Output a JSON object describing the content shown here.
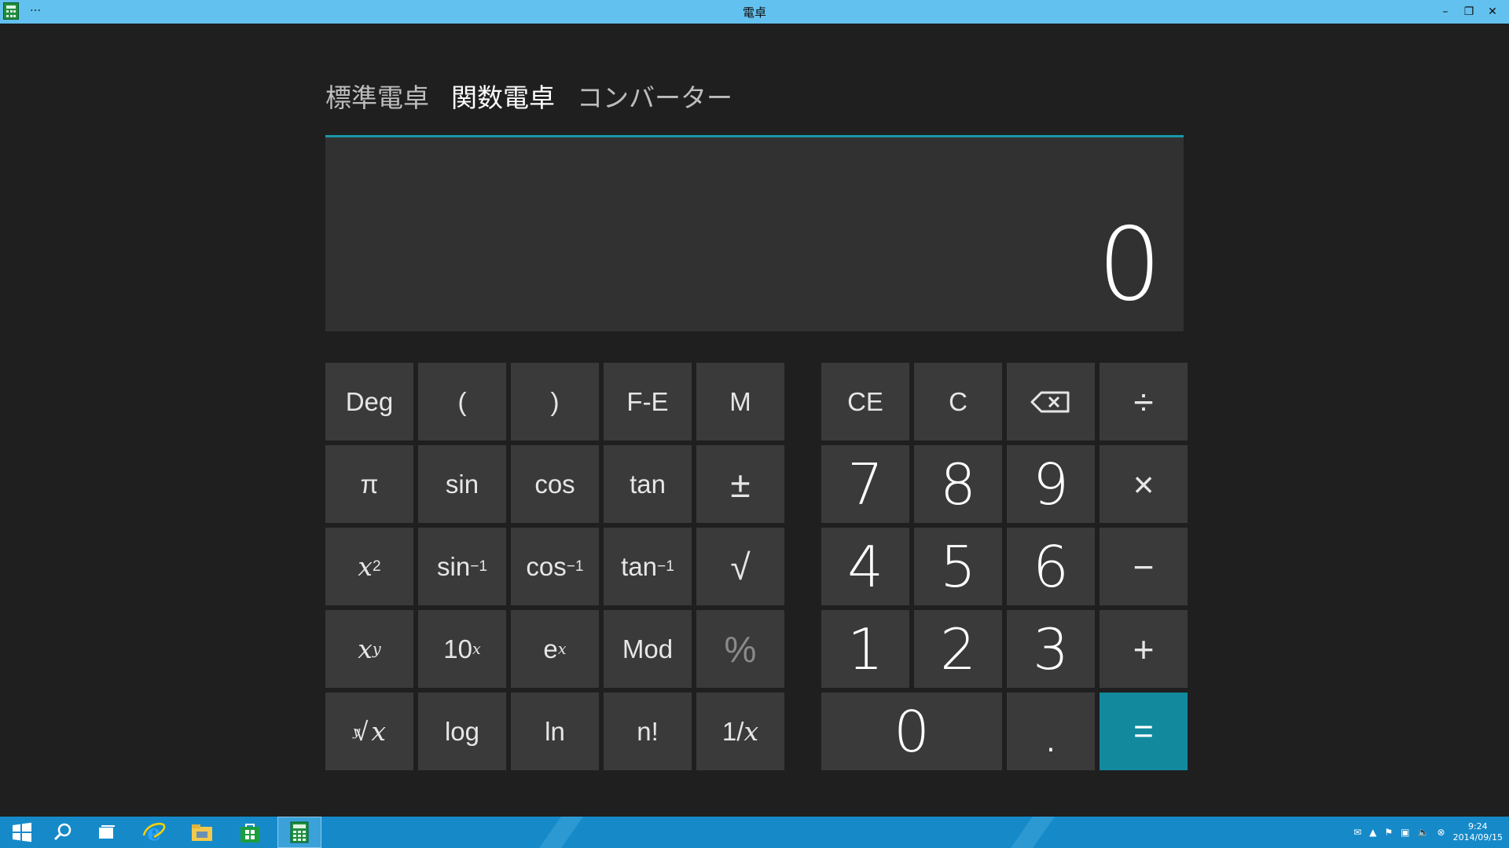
{
  "window": {
    "title": "電卓",
    "menu_glyph": "…",
    "controls": {
      "minimize": "–",
      "restore": "❐",
      "close": "✕"
    }
  },
  "tabs": [
    {
      "label": "標準電卓",
      "active": false
    },
    {
      "label": "関数電卓",
      "active": true
    },
    {
      "label": "コンバーター",
      "active": false
    }
  ],
  "display": {
    "value": "0"
  },
  "scientific_keys": {
    "deg": "Deg",
    "open_paren": "(",
    "close_paren": ")",
    "fe": "F-E",
    "memory": "M",
    "pi": "π",
    "sin": "sin",
    "cos": "cos",
    "tan": "tan",
    "plus_minus": "±",
    "square_base": "x",
    "square_exp": "2",
    "asin_base": "sin",
    "asin_exp": "−1",
    "acos_base": "cos",
    "acos_exp": "−1",
    "atan_base": "tan",
    "atan_exp": "−1",
    "sqrt": "√",
    "pow_base": "x",
    "pow_exp": "y",
    "ten_pow_base": "10",
    "ten_pow_exp": "x",
    "exp_base": "e",
    "exp_exp": "x",
    "mod": "Mod",
    "percent": "%",
    "root_index": "y",
    "root_symbol": "√",
    "root_x": "x",
    "log": "log",
    "ln": "ln",
    "factorial": "n!",
    "reciprocal_one": "1/",
    "reciprocal_x": "x"
  },
  "number_keys": {
    "ce": "CE",
    "c": "C",
    "divide": "÷",
    "seven": "7",
    "eight": "8",
    "nine": "9",
    "multiply": "×",
    "four": "4",
    "five": "5",
    "six": "6",
    "minus": "−",
    "one": "1",
    "two": "2",
    "three": "3",
    "plus": "+",
    "zero": "0",
    "decimal": ".",
    "equals": "="
  },
  "taskbar": {
    "time": "9:24",
    "date": "2014/09/15",
    "items": [
      "start-icon",
      "search-icon",
      "task-view-icon",
      "internet-explorer-icon",
      "file-explorer-icon",
      "store-icon",
      "calculator-icon"
    ]
  },
  "colors": {
    "titlebar": "#63c1ef",
    "accent": "#12899d",
    "display_border": "#1a97a8",
    "key_bg": "#3a3a3a",
    "background": "#1f1f1f",
    "taskbar": "#168ac9"
  }
}
